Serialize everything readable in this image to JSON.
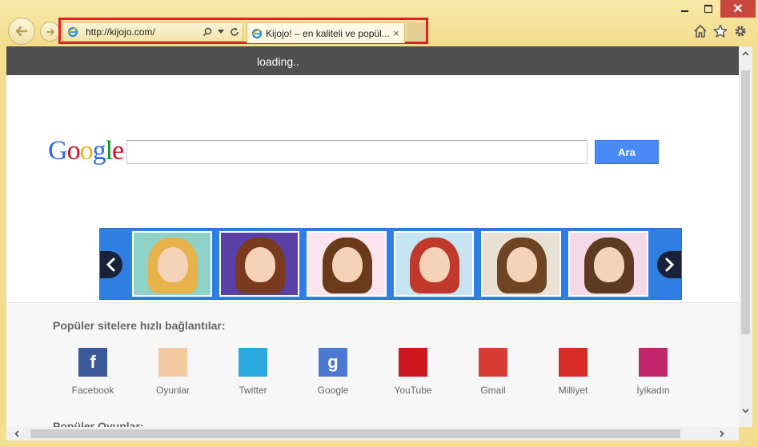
{
  "browser": {
    "address_url": "http://kijojo.com/",
    "tab_title": "Kijojo! – en kaliteli ve popül...",
    "tab_close": "×"
  },
  "page": {
    "loading_text": "loading..",
    "google_logo": [
      "G",
      "o",
      "o",
      "g",
      "l",
      "e"
    ],
    "google_logo_colors": [
      "#3369e8",
      "#d50f25",
      "#eeb211",
      "#3369e8",
      "#009925",
      "#d50f25"
    ],
    "search_button": "Ara",
    "search_value": "",
    "popular_heading": "Popüler sitelere hızlı bağlantılar:",
    "games_heading": "Popüler Oyunlar:",
    "sites": [
      {
        "label": "Facebook",
        "icon": "facebook-icon",
        "color": "#3b5998",
        "glyph": "f"
      },
      {
        "label": "Oyunlar",
        "icon": "oyunlar-icon",
        "color": "#f3c9a2",
        "glyph": ""
      },
      {
        "label": "Twitter",
        "icon": "twitter-icon",
        "color": "#2aa9e0",
        "glyph": ""
      },
      {
        "label": "Google",
        "icon": "google-icon",
        "color": "#4a78d2",
        "glyph": "g"
      },
      {
        "label": "YouTube",
        "icon": "youtube-icon",
        "color": "#cc181e",
        "glyph": ""
      },
      {
        "label": "Gmail",
        "icon": "gmail-icon",
        "color": "#d73d32",
        "glyph": ""
      },
      {
        "label": "Milliyet",
        "icon": "milliyet-icon",
        "color": "#d72b25",
        "glyph": ""
      },
      {
        "label": "İyikadın",
        "icon": "iyikadin-icon",
        "color": "#c2266a",
        "glyph": ""
      }
    ],
    "carousel_thumbs": [
      {
        "bg": "#8fd3c8",
        "hair": "#e8b24a"
      },
      {
        "bg": "#5a3fa6",
        "hair": "#7a3a1d"
      },
      {
        "bg": "#fbe6ef",
        "hair": "#6b3a1a"
      },
      {
        "bg": "#c7e4f3",
        "hair": "#c0392b"
      },
      {
        "bg": "#e9e1d6",
        "hair": "#6d4524"
      },
      {
        "bg": "#f4d9e6",
        "hair": "#5e3a21"
      }
    ]
  }
}
